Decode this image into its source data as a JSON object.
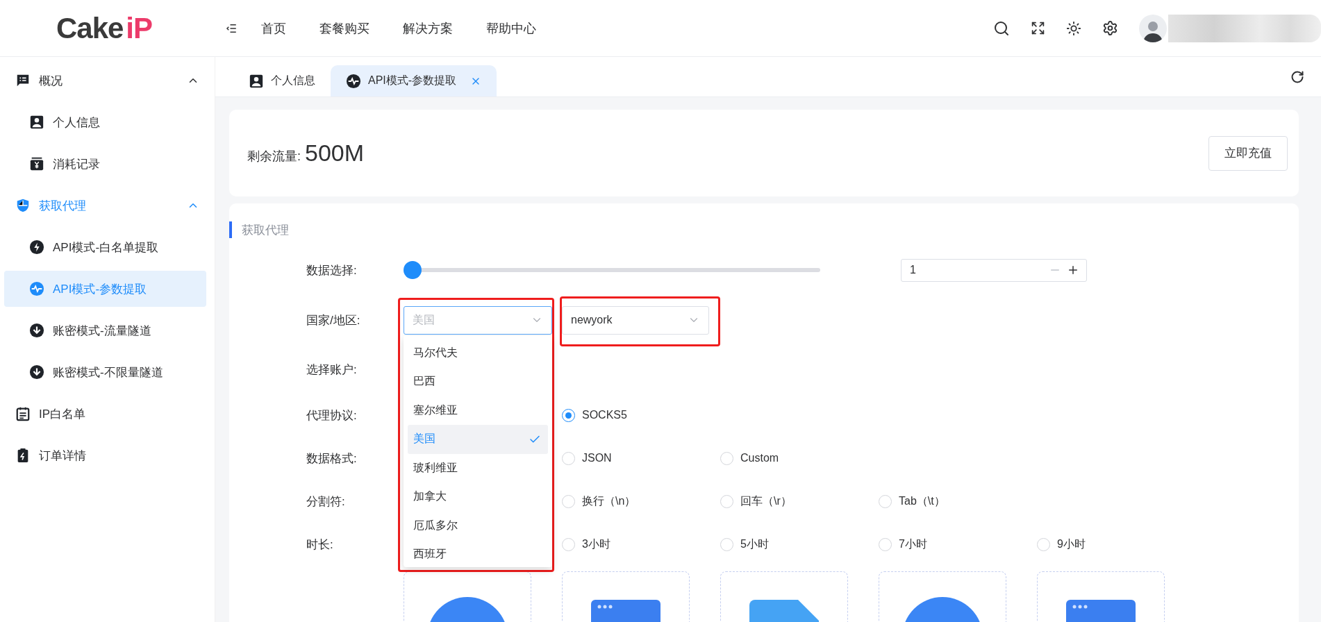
{
  "header": {
    "logo": {
      "main": "Cake",
      "accent": "iP"
    },
    "nav": [
      {
        "label": "首页"
      },
      {
        "label": "套餐购买"
      },
      {
        "label": "解决方案"
      },
      {
        "label": "帮助中心"
      }
    ]
  },
  "sidebar": {
    "items": [
      {
        "label": "概况",
        "expanded": true,
        "children": [
          {
            "label": "个人信息",
            "selected": false
          },
          {
            "label": "消耗记录",
            "selected": false
          }
        ]
      },
      {
        "label": "获取代理",
        "expanded": true,
        "children": [
          {
            "label": "API模式-白名单提取",
            "selected": false
          },
          {
            "label": "API模式-参数提取",
            "selected": true
          },
          {
            "label": "账密模式-流量隧道",
            "selected": false
          },
          {
            "label": "账密模式-不限量隧道",
            "selected": false
          }
        ]
      },
      {
        "label": "IP白名单",
        "selected": false
      },
      {
        "label": "订单详情",
        "selected": false
      }
    ]
  },
  "tabs": [
    {
      "label": "个人信息",
      "selected": false,
      "closable": false
    },
    {
      "label": "API模式-参数提取",
      "selected": true,
      "closable": true
    }
  ],
  "balance": {
    "label": "剩余流量:",
    "value": "500M",
    "button": "立即充值"
  },
  "section": {
    "title": "获取代理"
  },
  "form": {
    "quantity": {
      "label": "数据选择:",
      "level": 0,
      "value": "1"
    },
    "region": {
      "label": "国家/地区:",
      "country": {
        "placeholder": "美国",
        "open": true,
        "highlighted": true,
        "options": [
          {
            "label": "马尔代夫",
            "selected": false
          },
          {
            "label": "巴西",
            "selected": false
          },
          {
            "label": "塞尔维亚",
            "selected": false
          },
          {
            "label": "美国",
            "selected": true
          },
          {
            "label": "玻利维亚",
            "selected": false
          },
          {
            "label": "加拿大",
            "selected": false
          },
          {
            "label": "厄瓜多尔",
            "selected": false
          },
          {
            "label": "西班牙",
            "selected": false
          }
        ]
      },
      "city": {
        "value": "newyork",
        "open": false,
        "highlighted": true
      }
    },
    "account": {
      "label": "选择账户:"
    },
    "radio_groups": [
      {
        "label": "代理协议:",
        "options": [
          {
            "label": "SOCKS5",
            "selected": true
          }
        ]
      },
      {
        "label": "数据格式:",
        "options": [
          {
            "label": "JSON",
            "selected": false
          },
          {
            "label": "Custom",
            "selected": false
          }
        ]
      },
      {
        "label": "分割符:",
        "options": [
          {
            "label": "换行（\\n）",
            "selected": false
          },
          {
            "label": "回车（\\r）",
            "selected": false
          },
          {
            "label": "Tab（\\t）",
            "selected": false
          }
        ]
      },
      {
        "label": "时长:",
        "options": [
          {
            "label": "3小时",
            "selected": false
          },
          {
            "label": "5小时",
            "selected": false
          },
          {
            "label": "7小时",
            "selected": false
          },
          {
            "label": "9小时",
            "selected": false
          }
        ]
      }
    ]
  }
}
